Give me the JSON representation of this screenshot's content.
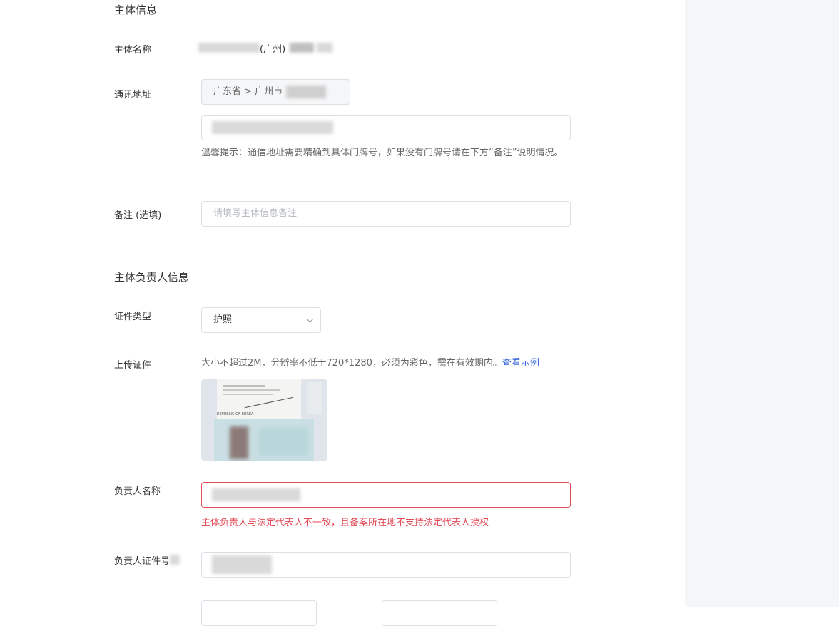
{
  "subject_info": {
    "section_title": "主体信息",
    "name_label": "主体名称",
    "name_value_visible": "(广州)",
    "address_label": "通讯地址",
    "address_region": "广东省 > 广州市",
    "address_hint": "温馨提示：通信地址需要精确到具体门牌号，如果没有门牌号请在下方“备注”说明情况。",
    "remark_label": "备注 (选填)",
    "remark_placeholder": "请填写主体信息备注"
  },
  "principal_info": {
    "section_title": "主体负责人信息",
    "id_type_label": "证件类型",
    "id_type_value": "护照",
    "upload_label": "上传证件",
    "upload_hint": "大小不超过2M，分辨率不低于720*1280，必须为彩色，需在有效期内。",
    "upload_example_link": "查看示例",
    "doc_image_text": "REPUBLIC OF KOREA",
    "name_label": "负责人名称",
    "name_error": "主体负责人与法定代表人不一致，且备案所在地不支持法定代表人授权",
    "id_number_label": "负责人证件号"
  },
  "colors": {
    "error": "#e34d59",
    "link": "#2a5bd7",
    "border": "#dcdfe6",
    "sidebar_bg": "#f5f6f8"
  }
}
